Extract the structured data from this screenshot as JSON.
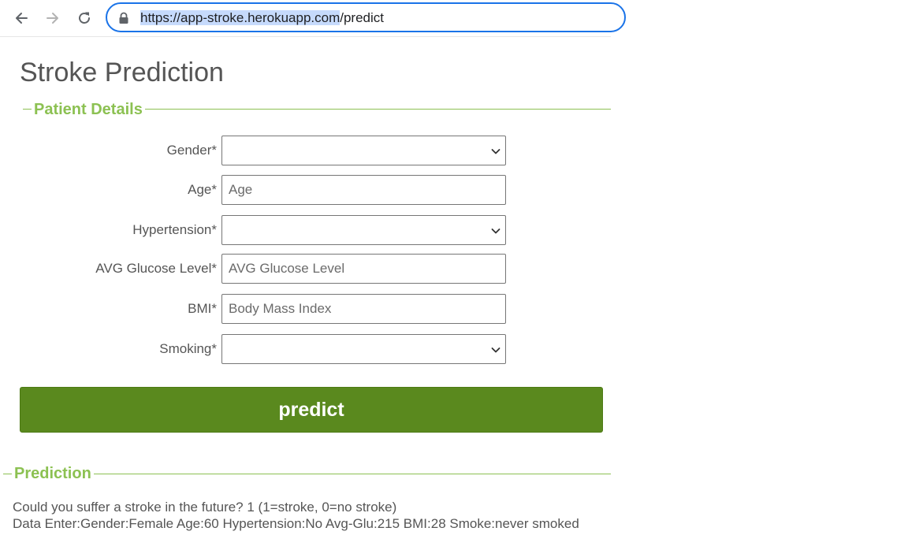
{
  "browser": {
    "url_host": "https://app-stroke.herokuapp.com",
    "url_path": "/predict"
  },
  "page": {
    "title": "Stroke Prediction"
  },
  "patient_section": {
    "legend": "Patient Details",
    "fields": {
      "gender": {
        "label": "Gender*",
        "value": ""
      },
      "age": {
        "label": "Age*",
        "placeholder": "Age",
        "value": ""
      },
      "hypertension": {
        "label": "Hypertension*",
        "value": ""
      },
      "glucose": {
        "label": "AVG Glucose Level*",
        "placeholder": "AVG Glucose Level",
        "value": ""
      },
      "bmi": {
        "label": "BMI*",
        "placeholder": "Body Mass Index",
        "value": ""
      },
      "smoking": {
        "label": "Smoking*",
        "value": ""
      }
    },
    "predict_label": "predict"
  },
  "prediction_section": {
    "legend": "Prediction",
    "result_line": "Could you suffer a stroke in the future? 1 (1=stroke, 0=no stroke)",
    "data_line": "Data Enter:Gender:Female Age:60 Hypertension:No Avg-Glu:215 BMI:28 Smoke:never smoked"
  },
  "colors": {
    "accent_green": "#8cc152",
    "button_green": "#5a891e",
    "omnibox_focus": "#1a73e8",
    "url_selection": "#c6dafc"
  },
  "icons": [
    "back-arrow-icon",
    "forward-arrow-icon",
    "reload-icon",
    "lock-icon",
    "chevron-down-icon"
  ]
}
